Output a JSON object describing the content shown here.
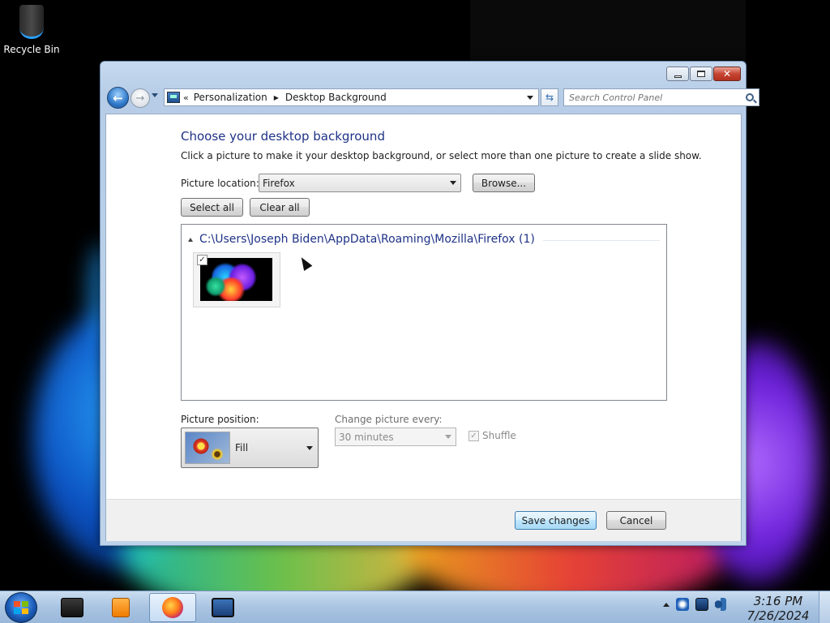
{
  "desktop": {
    "icons": [
      {
        "label": "Recycle Bin",
        "icon": "recycle-bin-icon"
      }
    ]
  },
  "window": {
    "caption_buttons": [
      "minimize-icon",
      "maximize-icon",
      "close-icon"
    ],
    "breadcrumb": [
      "Personalization",
      "Desktop Background"
    ],
    "search_placeholder": "Search Control Panel",
    "title": "Choose your desktop background",
    "description": "Click a picture to make it your desktop background, or select more than one picture to create a slide show.",
    "picture_location_label": "Picture location:",
    "picture_location_value": "Firefox",
    "browse_label": "Browse...",
    "select_all_label": "Select all",
    "clear_all_label": "Clear all",
    "group_header": "C:\\Users\\Joseph Biden\\AppData\\Roaming\\Mozilla\\Firefox (1)",
    "thumbnail_checked": "✓",
    "picture_position_label": "Picture position:",
    "picture_position_value": "Fill",
    "change_picture_label": "Change picture every:",
    "change_picture_value": "30 minutes",
    "shuffle_label": "Shuffle",
    "shuffle_checked": "✓",
    "save_label": "Save changes",
    "cancel_label": "Cancel"
  },
  "taskbar": {
    "items": [
      "windows-explorer-icon",
      "media-player-icon",
      "firefox-icon",
      "control-panel-icon"
    ],
    "active_item": "firefox-icon",
    "tray_icons": [
      "show-hidden-icons-icon",
      "action-center-icon",
      "network-icon",
      "volume-icon"
    ],
    "time": "3:16 PM",
    "date": "7/26/2024"
  },
  "colors": {
    "accent": "#1e3287",
    "taskbar": "#a9c4e2",
    "window_frame": "#bed3ea"
  }
}
